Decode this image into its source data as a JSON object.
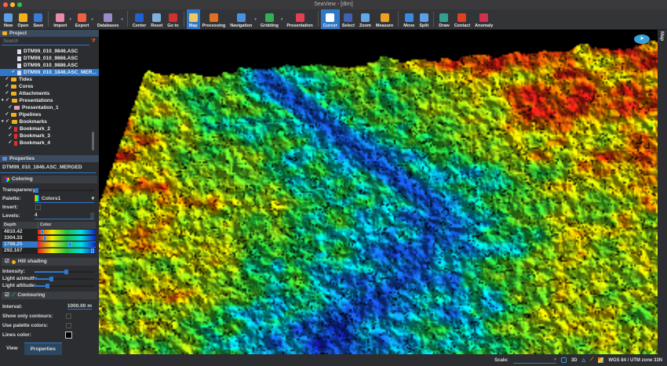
{
  "window": {
    "title": "SeaView - [dtm]"
  },
  "toolbar": [
    {
      "label": "New",
      "color": "#5aa0e8"
    },
    {
      "label": "Open",
      "color": "#f0b020"
    },
    {
      "label": "Save",
      "color": "#3a7ad8"
    },
    {
      "sep": true
    },
    {
      "label": "Import",
      "color": "#e88aa8",
      "drop": true
    },
    {
      "label": "Export",
      "color": "#f06040",
      "drop": true
    },
    {
      "label": "Databases",
      "color": "#9a8ac8",
      "drop": true
    },
    {
      "sep": true
    },
    {
      "label": "Center",
      "color": "#2060d0"
    },
    {
      "label": "Reset",
      "color": "#80b0e0"
    },
    {
      "label": "Go to",
      "color": "#d03030"
    },
    {
      "sep": true
    },
    {
      "label": "Map",
      "color": "#f0c860",
      "active": true
    },
    {
      "label": "Processing",
      "color": "#e07020"
    },
    {
      "label": "Navigation",
      "color": "#4a90e0",
      "drop": true
    },
    {
      "label": "Gridding",
      "color": "#30b050",
      "drop": true
    },
    {
      "label": "Presentation",
      "color": "#e04050"
    },
    {
      "sep": true
    },
    {
      "label": "Cursor",
      "color": "#ffffff",
      "active": true
    },
    {
      "label": "Select",
      "color": "#4060b0"
    },
    {
      "label": "Zoom",
      "color": "#60a8e8"
    },
    {
      "label": "Measure",
      "color": "#f0a020"
    },
    {
      "sep": true
    },
    {
      "label": "Move",
      "color": "#3a8ae0"
    },
    {
      "label": "Split",
      "color": "#5aa0e8"
    },
    {
      "sep": true
    },
    {
      "label": "Draw",
      "color": "#30a090"
    },
    {
      "label": "Contact",
      "color": "#e04020"
    },
    {
      "label": "Anomaly",
      "color": "#d03050"
    }
  ],
  "project": {
    "title": "Project",
    "search_placeholder": "Search",
    "items": [
      {
        "label": "DTM99_010_9846.ASC",
        "type": "file",
        "indent": 3,
        "check": ""
      },
      {
        "label": "DTM99_010_9866.ASC",
        "type": "file",
        "indent": 3,
        "check": ""
      },
      {
        "label": "DTM99_010_9886.ASC",
        "type": "file",
        "indent": 3,
        "check": ""
      },
      {
        "label": "DTM99_010_1846.ASC_MER...",
        "type": "file",
        "indent": 3,
        "check": "✓",
        "selected": true
      },
      {
        "label": "Tides",
        "type": "folder",
        "indent": 1,
        "check": "✓"
      },
      {
        "label": "Cores",
        "type": "folder",
        "indent": 1,
        "check": "✓"
      },
      {
        "label": "Attachments",
        "type": "folder",
        "indent": 1,
        "check": "✓"
      },
      {
        "label": "Presentations",
        "type": "folder",
        "indent": 0,
        "check": "✓",
        "expand": true
      },
      {
        "label": "Presentation_1",
        "type": "pres",
        "indent": 2,
        "check": "✓"
      },
      {
        "label": "Pipelines",
        "type": "folder",
        "indent": 1,
        "check": "✓"
      },
      {
        "label": "Bookmarks",
        "type": "folder",
        "indent": 0,
        "check": "✓",
        "expand": true
      },
      {
        "label": "Bookmark_2",
        "type": "bm",
        "indent": 2,
        "check": "✓"
      },
      {
        "label": "Bookmark_3",
        "type": "bm",
        "indent": 2,
        "check": "✓"
      },
      {
        "label": "Bookmark_4",
        "type": "bm",
        "indent": 2,
        "check": "✓"
      }
    ]
  },
  "properties": {
    "title": "Properties",
    "name": "DTM99_010_1846.ASC_MERGED",
    "coloring": "Coloring",
    "transparency_label": "Transparency:",
    "transparency": 0.03,
    "palette_label": "Palette:",
    "palette": "Colors1",
    "invert_label": "Invert:",
    "levels_label": "Levels:",
    "levels": "4",
    "depth_header": "Depth",
    "color_header": "Color",
    "depths": [
      {
        "value": "4810.42",
        "pos": 0.05
      },
      {
        "value": "3304.33",
        "pos": 0.1
      },
      {
        "value": "1798.25",
        "pos": 0.55,
        "selected": true
      },
      {
        "value": "292.167",
        "pos": 0.97
      }
    ],
    "hill_shading": "Hill shading",
    "intensity_label": "Intensity:",
    "intensity": 0.5,
    "azimuth_label": "Light azimuth:",
    "azimuth": 0.25,
    "altitude_label": "Light altitude:",
    "altitude": 0.18,
    "contouring": "Contouring",
    "interval_label": "Interval:",
    "interval": "1000.00 m",
    "show_only_label": "Show only contours:",
    "use_palette_label": "Use palette colors:",
    "lines_color_label": "Lines color:"
  },
  "tabs": {
    "view": "View",
    "properties": "Properties"
  },
  "map": {
    "side_tab": "Map"
  },
  "status": {
    "scale_label": "Scale:",
    "mode_3d": "3D",
    "crs": "WGS 84 / UTM zone 33N"
  }
}
